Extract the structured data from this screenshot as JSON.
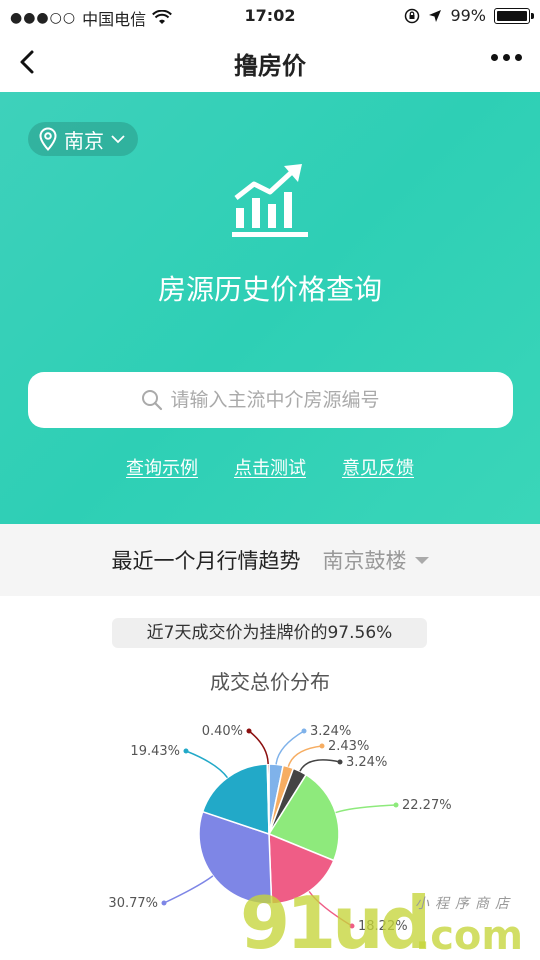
{
  "status_bar": {
    "carrier": "中国电信",
    "time": "17:02",
    "battery": "99%"
  },
  "nav": {
    "title": "撸房价"
  },
  "hero": {
    "city": "南京",
    "title": "房源历史价格查询",
    "search_placeholder": "请输入主流中介房源编号",
    "links": [
      "查询示例",
      "点击测试",
      "意见反馈"
    ]
  },
  "trend": {
    "title": "最近一个月行情趋势",
    "area": "南京鼓楼"
  },
  "summary": "近7天成交价为挂牌价的97.56%",
  "chart_title": "成交总价分布",
  "chart_data": {
    "type": "pie",
    "title": "成交总价分布",
    "labels": [
      "3.24%",
      "2.43%",
      "3.24%",
      "22.27%",
      "18.22%",
      "30.77%",
      "19.43%",
      "0.40%"
    ],
    "values": [
      3.24,
      2.43,
      3.24,
      22.27,
      18.22,
      30.77,
      19.43,
      0.4
    ],
    "colors": [
      "#7fb2ea",
      "#f6ad62",
      "#444444",
      "#8eea7c",
      "#ef5d86",
      "#7e86e6",
      "#22a9c8",
      "#8b0f0f"
    ]
  },
  "watermark": {
    "big": "91ud",
    "com": ".com",
    "cn": "小程序商店"
  }
}
